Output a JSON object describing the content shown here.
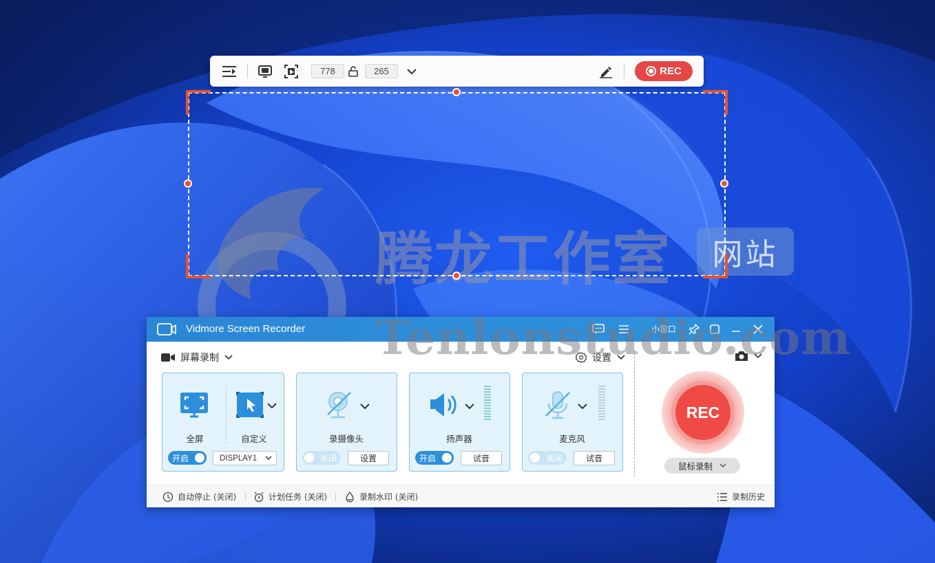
{
  "region_toolbar": {
    "width_value": "778",
    "height_value": "265",
    "rec_label": "REC"
  },
  "watermark": {
    "cn_text": "腾龙工作室",
    "badge_text": "网站",
    "en_text": "Tenlonstudio.com"
  },
  "app": {
    "title": "Vidmore Screen Recorder",
    "mini_window_label": "小窗口",
    "section_label": "屏幕录制",
    "settings_label": "设置",
    "cards": {
      "display": {
        "fullscreen_label": "全屏",
        "custom_label": "自定义",
        "toggle_label": "开启",
        "display_select": "DISPLAY1"
      },
      "webcam": {
        "label": "录摄像头",
        "toggle_label": "关闭",
        "button_label": "设置"
      },
      "speaker": {
        "label": "扬声器",
        "toggle_label": "开启",
        "button_label": "试音"
      },
      "microphone": {
        "label": "麦克风",
        "toggle_label": "关闭",
        "button_label": "试音"
      }
    },
    "rec_button_label": "REC",
    "mouse_record_label": "鼠标录制",
    "footer": {
      "auto_stop": "自动停止 (关闭)",
      "schedule": "计划任务 (关闭)",
      "watermark": "录制水印 (关闭)",
      "history": "录制历史"
    }
  },
  "colors": {
    "accent": "#2d8fdc",
    "rec_red": "#e64646",
    "selection_orange": "#e8522e",
    "card_bg": "#e3f3fc"
  }
}
